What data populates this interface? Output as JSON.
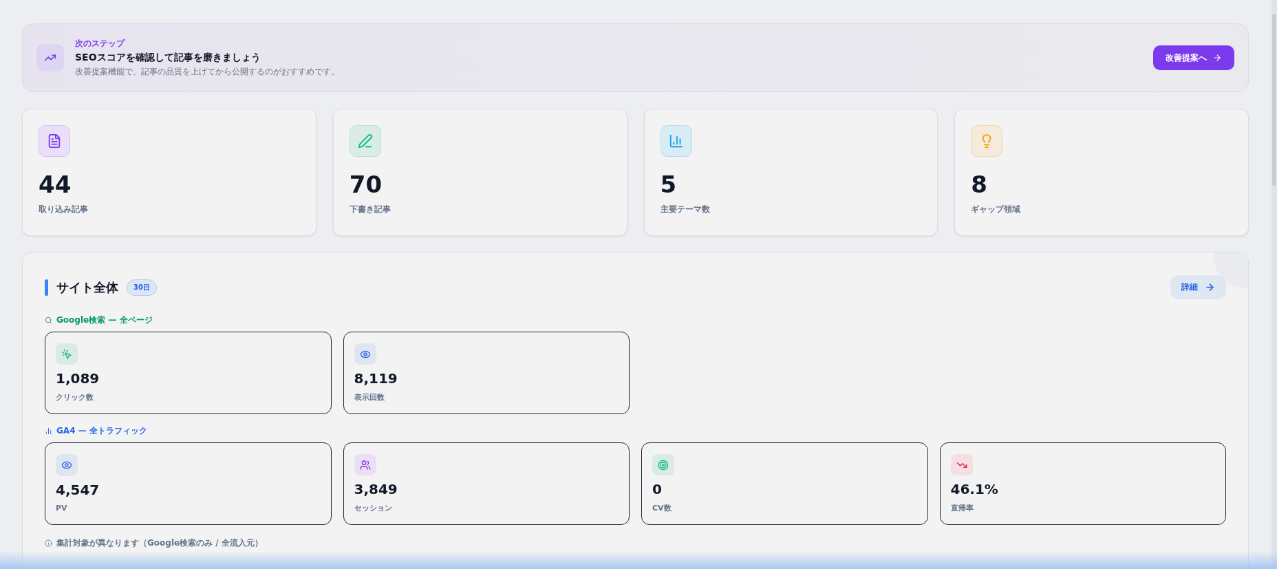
{
  "banner": {
    "eyebrow": "次のステップ",
    "title": "SEOスコアを確認して記事を磨きましょう",
    "description": "改善提案機能で、記事の品質を上げてから公開するのがおすすめです。",
    "button": "改善提案へ"
  },
  "stats": [
    {
      "kind": "document",
      "value": "44",
      "label": "取り込み記事"
    },
    {
      "kind": "pen",
      "value": "70",
      "label": "下書き記事"
    },
    {
      "kind": "chart",
      "value": "5",
      "label": "主要テーマ数"
    },
    {
      "kind": "bulb",
      "value": "8",
      "label": "ギャップ領域"
    }
  ],
  "section": {
    "title": "サイト全体",
    "badge": "30日",
    "button": "詳細",
    "groups": [
      {
        "kind": "search",
        "label": "Google検索 — 全ページ",
        "metrics": [
          {
            "kind": "click",
            "value": "1,089",
            "label": "クリック数"
          },
          {
            "kind": "eye",
            "value": "8,119",
            "label": "表示回数"
          }
        ]
      },
      {
        "kind": "ga4",
        "label": "GA4 — 全トラフィック",
        "metrics": [
          {
            "kind": "eye",
            "value": "4,547",
            "label": "PV"
          },
          {
            "kind": "users",
            "value": "3,849",
            "label": "セッション"
          },
          {
            "kind": "target",
            "value": "0",
            "label": "CV数"
          },
          {
            "kind": "down",
            "value": "46.1%",
            "label": "直帰率"
          }
        ]
      }
    ],
    "note": "集計対象が異なります（Google検索のみ / 全流入元）"
  }
}
